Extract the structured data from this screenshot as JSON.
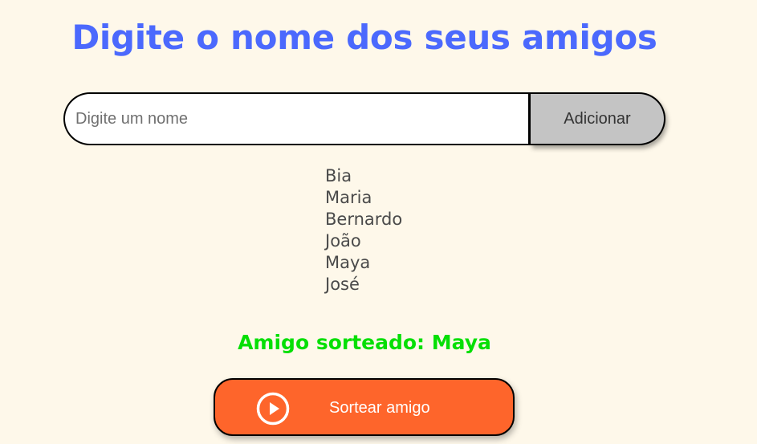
{
  "header": {
    "title": "Digite o nome dos seus amigos"
  },
  "form": {
    "placeholder": "Digite um nome",
    "value": "",
    "add_label": "Adicionar"
  },
  "friends": [
    "Bia",
    "Maria",
    "Bernardo",
    "João",
    "Maya",
    "José"
  ],
  "result": {
    "text": "Amigo sorteado: Maya"
  },
  "draw_button": {
    "label": "Sortear amigo",
    "icon": "play-circle-icon"
  },
  "colors": {
    "background": "#FEF8EA",
    "title": "#4B69FD",
    "result": "#05DF05",
    "draw_button": "#FE652B",
    "add_button": "#C4C4C4"
  }
}
